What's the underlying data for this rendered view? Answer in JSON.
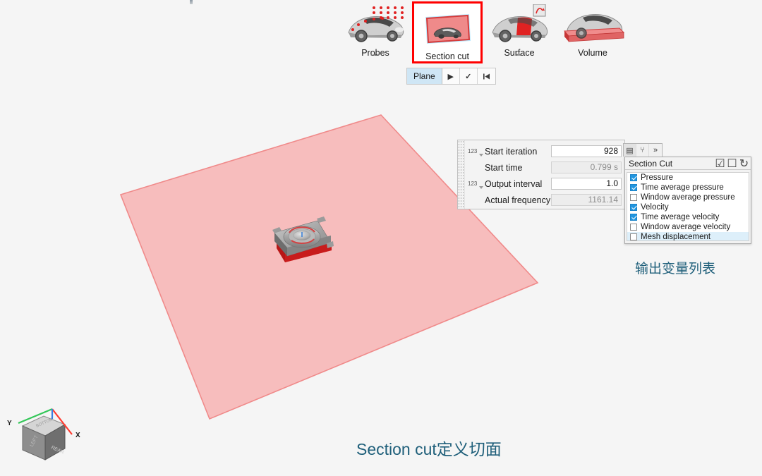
{
  "app": {
    "background_color": "#f5f5f5",
    "accent_annotation_color": "#1f5f7a",
    "highlight_color": "#ff0000",
    "plane_color": "#f6b2b2"
  },
  "ribbon": {
    "items": [
      {
        "label": "Probes",
        "icon": "car-probes-icon",
        "selected": false
      },
      {
        "label": "Section cut",
        "icon": "car-section-cut-icon",
        "selected": true
      },
      {
        "label": "Surface",
        "icon": "car-surface-icon",
        "selected": false
      },
      {
        "label": "Volume",
        "icon": "car-volume-icon",
        "selected": false
      }
    ]
  },
  "plane_toolbar": {
    "label": "Plane",
    "buttons": [
      {
        "name": "play-button",
        "glyph": "▶"
      },
      {
        "name": "confirm-button",
        "glyph": "✓"
      },
      {
        "name": "reset-button",
        "glyph": "⏮"
      }
    ]
  },
  "properties": {
    "rows": [
      {
        "badge": "123",
        "label": "Start iteration",
        "value": "928",
        "readonly": false
      },
      {
        "badge": "",
        "label": "Start time",
        "value": "0.799 s",
        "readonly": true
      },
      {
        "badge": "123",
        "label": "Output interval",
        "value": "1.0",
        "readonly": false
      },
      {
        "badge": "",
        "label": "Actual frequency",
        "value": "1161.14",
        "readonly": true
      }
    ]
  },
  "variable_panel": {
    "tabs": [
      {
        "name": "list-view-icon",
        "glyph": "▤",
        "active": true
      },
      {
        "name": "tree-view-icon",
        "glyph": "⑂",
        "active": false
      },
      {
        "name": "expand-all-icon",
        "glyph": "»",
        "active": false
      }
    ],
    "title": "Section Cut",
    "header_icons": [
      {
        "name": "check-all-icon",
        "glyph": "☑"
      },
      {
        "name": "uncheck-all-icon",
        "glyph": "☐"
      },
      {
        "name": "refresh-icon",
        "glyph": "↻"
      }
    ],
    "variables": [
      {
        "label": "Pressure",
        "checked": true,
        "selected": false
      },
      {
        "label": "Time average pressure",
        "checked": true,
        "selected": false
      },
      {
        "label": "Window average pressure",
        "checked": false,
        "selected": false
      },
      {
        "label": "Velocity",
        "checked": true,
        "selected": false
      },
      {
        "label": "Time average velocity",
        "checked": true,
        "selected": false
      },
      {
        "label": "Window average velocity",
        "checked": false,
        "selected": false
      },
      {
        "label": "Mesh displacement",
        "checked": false,
        "selected": true
      }
    ]
  },
  "annotations": {
    "variable_list": "输出变量列表",
    "caption": "Section cut定义切面"
  },
  "axis_triad": {
    "x_label": "X",
    "y_label": "Y",
    "x_color": "#ff3b30",
    "y_color": "#34c759",
    "z_color": "#3b7fe0"
  }
}
